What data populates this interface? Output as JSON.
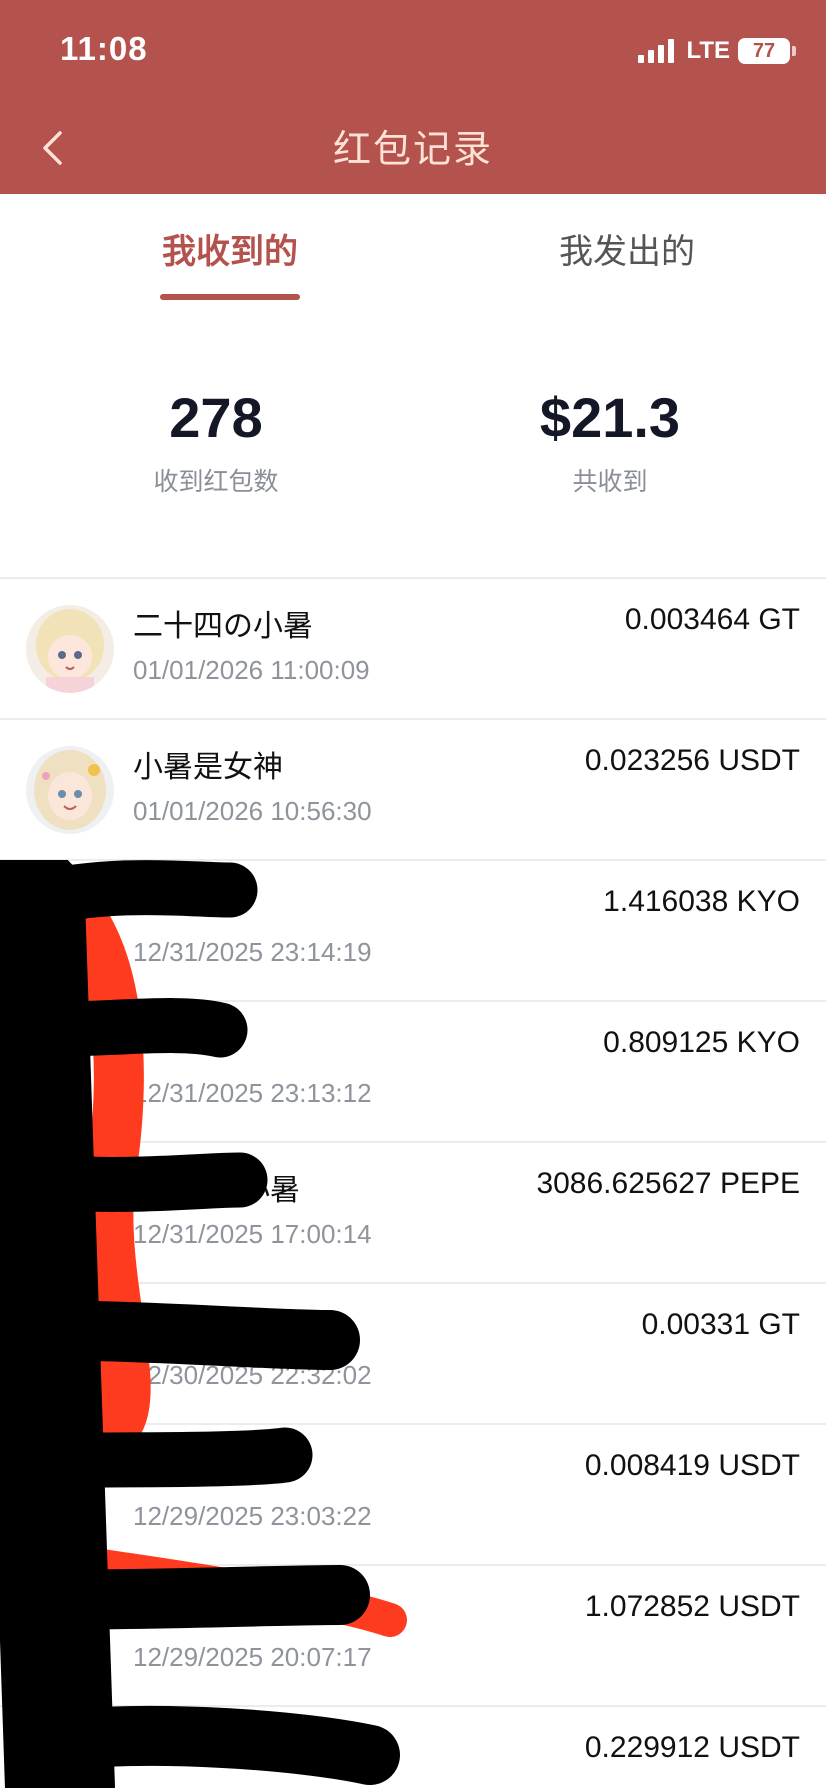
{
  "status_bar": {
    "time": "11:08",
    "network": "LTE",
    "battery": "77"
  },
  "header": {
    "title": "红包记录"
  },
  "tabs": [
    {
      "label": "我收到的",
      "active": true
    },
    {
      "label": "我发出的",
      "active": false
    }
  ],
  "stats": {
    "count_value": "278",
    "count_label": "收到红包数",
    "total_value": "$21.3",
    "total_label": "共收到"
  },
  "records": [
    {
      "name": "二十四の小暑",
      "time": "01/01/2026 11:00:09",
      "amount": "0.003464 GT"
    },
    {
      "name": "小暑是女神",
      "time": "01/01/2026 10:56:30",
      "amount": "0.023256 USDT"
    },
    {
      "name": "",
      "time": "12/31/2025 23:14:19",
      "amount": "1.416038 KYO"
    },
    {
      "name": "",
      "time": "12/31/2025 23:13:12",
      "amount": "0.809125 KYO"
    },
    {
      "name": "四の小暑",
      "time": "12/31/2025 17:00:14",
      "amount": "3086.625627 PEPE"
    },
    {
      "name": "",
      "time": "12/30/2025 22:32:02",
      "amount": "0.00331 GT"
    },
    {
      "name": "",
      "time": "12/29/2025 23:03:22",
      "amount": "0.008419 USDT"
    },
    {
      "name": "",
      "time": "12/29/2025 20:07:17",
      "amount": "1.072852 USDT"
    },
    {
      "name": "",
      "time": "",
      "amount": "0.229912 USDT"
    }
  ],
  "colors": {
    "header_bg": "#b4524e",
    "accent": "#b4524e",
    "title_text": "#ffe2d6"
  },
  "icons": {
    "back": "chevron-left-icon",
    "signal": "signal-icon",
    "battery": "battery-icon"
  }
}
